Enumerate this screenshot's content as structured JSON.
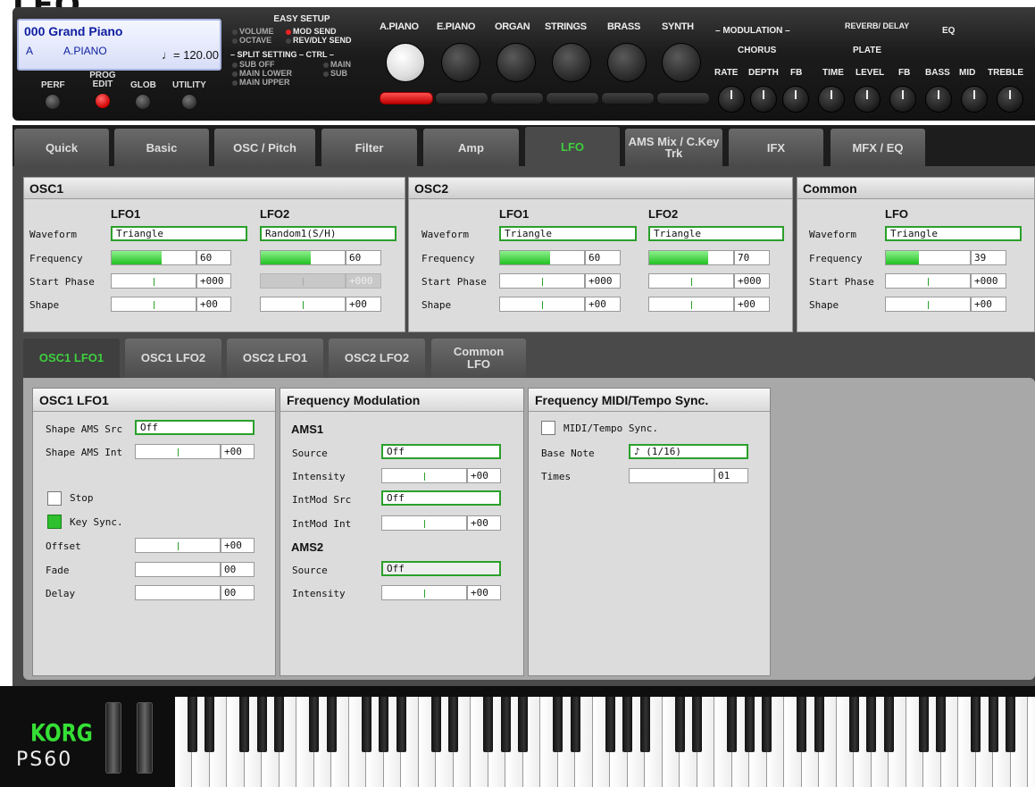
{
  "heading": "LFO",
  "header": {
    "prog_number": "000",
    "prog_name": "Grand Piano",
    "category": "A",
    "subcategory": "A.PIANO",
    "tempo": "= 120.00",
    "modes": [
      "PERF",
      "PROG EDIT",
      "GLOB",
      "UTILITY"
    ],
    "easy_setup": {
      "title": "EASY SETUP",
      "volume": "VOLUME",
      "mod_send": "MOD SEND",
      "octave": "OCTAVE",
      "revdly_send": "REV/DLY SEND",
      "split_title": "– SPLIT SETTING – CTRL –",
      "sub_off": "SUB OFF",
      "main": "MAIN",
      "main_lower": "MAIN LOWER",
      "sub": "SUB",
      "main_upper": "MAIN UPPER"
    },
    "categories": [
      "A.PIANO",
      "E.PIANO",
      "ORGAN",
      "STRINGS",
      "BRASS",
      "SYNTH"
    ],
    "modulation": {
      "title": "– MODULATION –",
      "value": "CHORUS",
      "rate": "RATE",
      "depth": "DEPTH",
      "fb": "FB"
    },
    "reverb": {
      "title": "REVERB/ DELAY",
      "value": "PLATE",
      "time": "TIME",
      "level": "LEVEL",
      "fb": "FB"
    },
    "eq": {
      "title": "EQ",
      "bass": "BASS",
      "mid": "MID",
      "treble": "TREBLE"
    }
  },
  "tabs": [
    "Quick",
    "Basic",
    "OSC / Pitch",
    "Filter",
    "Amp",
    "LFO",
    "AMS Mix / C.Key Trk",
    "IFX",
    "MFX / EQ"
  ],
  "active_tab": "LFO",
  "osc1": {
    "title": "OSC1",
    "lfo1": "LFO1",
    "lfo2": "LFO2",
    "labels": {
      "waveform": "Waveform",
      "frequency": "Frequency",
      "start_phase": "Start Phase",
      "shape": "Shape"
    },
    "lfo1_vals": {
      "waveform": "Triangle",
      "frequency": "60",
      "frequency_level": 0.6,
      "start_phase": "+000",
      "shape": "+00"
    },
    "lfo2_vals": {
      "waveform": "Random1(S/H)",
      "frequency": "60",
      "frequency_level": 0.6,
      "start_phase": "+000",
      "shape": "+00"
    }
  },
  "osc2": {
    "title": "OSC2",
    "lfo1": "LFO1",
    "lfo2": "LFO2",
    "labels": {
      "waveform": "Waveform",
      "frequency": "Frequency",
      "start_phase": "Start Phase",
      "shape": "Shape"
    },
    "lfo1_vals": {
      "waveform": "Triangle",
      "frequency": "60",
      "frequency_level": 0.6,
      "start_phase": "+000",
      "shape": "+00"
    },
    "lfo2_vals": {
      "waveform": "Triangle",
      "frequency": "70",
      "frequency_level": 0.7,
      "start_phase": "+000",
      "shape": "+00"
    }
  },
  "common": {
    "title": "Common",
    "lfo": "LFO",
    "labels": {
      "waveform": "Waveform",
      "frequency": "Frequency",
      "start_phase": "Start Phase",
      "shape": "Shape"
    },
    "vals": {
      "waveform": "Triangle",
      "frequency": "39",
      "frequency_level": 0.39,
      "start_phase": "+000",
      "shape": "+00"
    }
  },
  "subtabs": [
    "OSC1 LFO1",
    "OSC1 LFO2",
    "OSC2 LFO1",
    "OSC2 LFO2",
    "Common LFO"
  ],
  "osc1lfo1": {
    "title": "OSC1 LFO1",
    "shape_ams_src": "Shape AMS Src",
    "shape_ams_src_val": "Off",
    "shape_ams_int": "Shape AMS Int",
    "shape_ams_int_val": "+00",
    "stop": "Stop",
    "key_sync": "Key Sync.",
    "offset": "Offset",
    "offset_val": "+00",
    "fade": "Fade",
    "fade_val": "00",
    "delay": "Delay",
    "delay_val": "00"
  },
  "freqmod": {
    "title": "Frequency Modulation",
    "ams1": "AMS1",
    "source": "Source",
    "source_val": "Off",
    "intensity": "Intensity",
    "intensity_val": "+00",
    "intmod_src": "IntMod Src",
    "intmod_src_val": "Off",
    "intmod_int": "IntMod Int",
    "intmod_int_val": "+00",
    "ams2": "AMS2",
    "source2": "Source",
    "source2_val": "Off",
    "intensity2": "Intensity",
    "intensity2_val": "+00"
  },
  "sync": {
    "title": "Frequency MIDI/Tempo Sync.",
    "midi_sync": "MIDI/Tempo Sync.",
    "base_note": "Base Note",
    "base_note_val": "♪ (1/16)",
    "times": "Times",
    "times_val": "01"
  },
  "brand": {
    "logo": "KORG",
    "model": "PS60"
  }
}
